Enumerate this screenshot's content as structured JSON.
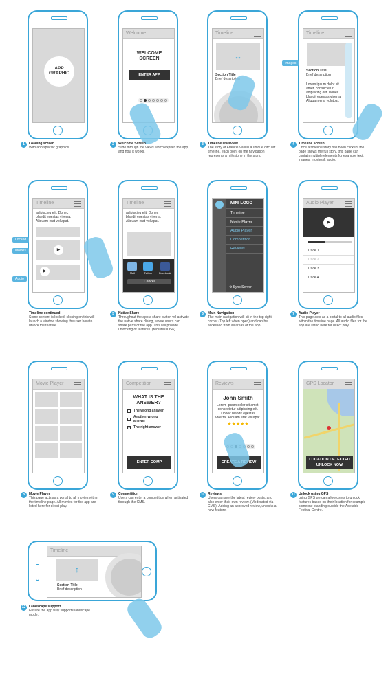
{
  "screens": [
    {
      "num": "1",
      "title": "Loading screen",
      "desc": "With app specific graphics.",
      "app_graphic": "APP GRAPHIC"
    },
    {
      "num": "2",
      "title": "Welcome Screen",
      "desc": "Slide through the views which explain the app, and how it works.",
      "bar": "Welcome",
      "headline": "WELCOME SCREEN",
      "button": "ENTER APP"
    },
    {
      "num": "3",
      "title": "Timeline Overview",
      "desc": "The story of Frankie Valli in a unique circular timeline, each point on the navigation represents a milestone in the story.",
      "bar": "Timeline",
      "section_title": "Section Title",
      "section_desc": "Brief description",
      "arrow": "↔"
    },
    {
      "num": "4",
      "title": "Timeline screen",
      "desc": "Once a timeline story has been clicked, the page shows the full story, this page can contain multiple elements for example text, images, movies & audio.",
      "bar": "Timeline",
      "tag": "Images",
      "section_title": "Section Title",
      "section_desc": "Brief description",
      "body": "Lorem ipsum dolor sit amet, consectetur adipiscing elit. Donec blandit egestas viverra. Aliquam erat volutpat."
    },
    {
      "num": "",
      "title": "Timeline continued",
      "desc": "Some content is locked, clicking on this will launch a window showing the user how to unlock the feature.",
      "bar": "Timeline",
      "body": "adipiscing elit. Donec blandit egestas viverra. Aliquam erat volutpat.",
      "tags": [
        "Locked",
        "Movies",
        "Audio"
      ]
    },
    {
      "num": "5",
      "title": "Native Share",
      "desc": "Throughout the app a share button wil activate the native share dialog, where users can share parts of the app. This will provide unlocking of features. (requires iOS6)",
      "bar": "Timeline",
      "body": "adipiscing elit. Donec blandit egestas viverra. Aliquam erat volutpat.",
      "share": [
        "Mail",
        "Twitter",
        "Facebook"
      ],
      "cancel": "Cancel"
    },
    {
      "num": "6",
      "title": "Main Navigation",
      "desc": "The main navigation will sit in the top right corner (Top left when open) and can be accessed from all areas of the app.",
      "logo": "MINI LOGO",
      "items": [
        "Timeline",
        "Movie Player",
        "Audio Player",
        "Competition",
        "Reviews"
      ],
      "sync": "Sync Server"
    },
    {
      "num": "7",
      "title": "Audio Player",
      "desc": "This page acts as a portal to all audio files within the timeline page. All audio files for the app are listed here for direct play.",
      "bar": "Audio Player",
      "tracks": [
        "Track 1",
        "Track 2",
        "Track 3",
        "Track 4"
      ]
    },
    {
      "num": "8",
      "title": "Movie Player",
      "desc": "This page acts as a portal to all movies within the timeline page. All movies for the app are listed here for direct play.",
      "bar": "Movie Player"
    },
    {
      "num": "9",
      "title": "Competition",
      "desc": "Users can enter a competition when activated through the CMS.",
      "bar": "Competition",
      "question": "WHAT IS THE ANSWER?",
      "answers": [
        "The wrong answer",
        "Another wrong answer",
        "The right answer"
      ],
      "button": "ENTER COMP"
    },
    {
      "num": "10",
      "title": "Reviews",
      "desc": "Users can see the latest review posts, and also enter their own review. (Moderated via CMS). Adding an approved review, unlocks a new feature.",
      "bar": "Reviews",
      "name": "John Smith",
      "body": "Lorem ipsum dolor sit amet, consectetur adipiscing elit. Donec blandit egestas viverra. Aliquam erat volutpat.",
      "stars": "★★★★★",
      "button": "CREATE A REVIEW"
    },
    {
      "num": "11",
      "title": "Unlock using GPS",
      "desc": "using GPS we can allow users to unlock features based on their location for example someone standing outside the Adelaide Festival Centre.",
      "bar": "GPS Locator",
      "banner": "LOCATION DETECTED UNLOCK NOW"
    },
    {
      "num": "12",
      "title": "Landscape support",
      "desc": "Ensure the app fully supports landscape mode.",
      "bar": "Timeline",
      "section_title": "Section Title",
      "section_desc": "Brief description",
      "arrow": "↕"
    }
  ]
}
